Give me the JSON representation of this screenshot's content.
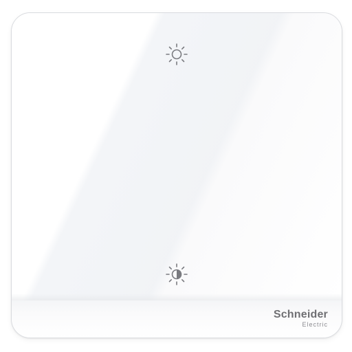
{
  "product": {
    "type": "smart-dimmer-switch",
    "color": "#ffffff",
    "accent": "#6f6f73"
  },
  "controls": {
    "top_icon": "brightness-up-icon",
    "bottom_icon": "brightness-down-icon"
  },
  "brand": {
    "name": "Schneider",
    "sub": "Electric"
  }
}
